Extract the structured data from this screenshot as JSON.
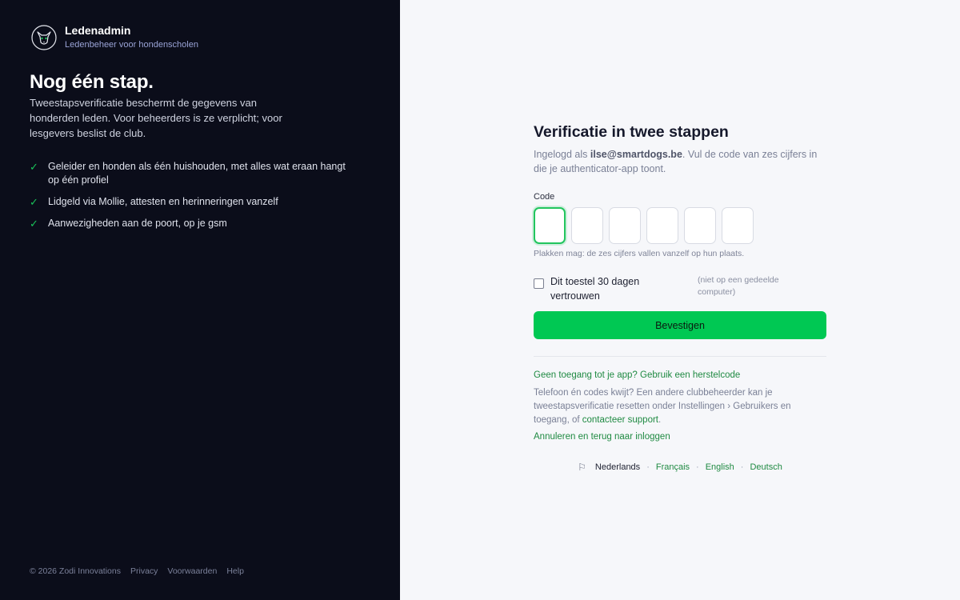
{
  "brand": {
    "name": "Ledenadmin",
    "subtitle": "Ledenbeheer voor hondenscholen"
  },
  "left": {
    "headline": "Nog één stap.",
    "intro": "Tweestapsverificatie beschermt de gegevens van honderden leden. Voor beheerders is ze verplicht; voor lesgevers beslist de club.",
    "features": [
      "Geleider en honden als één huishouden, met alles wat eraan hangt op één profiel",
      "Lidgeld via Mollie, attesten en herinneringen vanzelf",
      "Aanwezigheden aan de poort, op je gsm"
    ],
    "footer": {
      "copyright": "© 2026 Zodi Innovations",
      "privacy": "Privacy",
      "terms": "Voorwaarden",
      "help": "Help"
    }
  },
  "form": {
    "title": "Verificatie in twee stappen",
    "desc_prefix": "Ingelogd als ",
    "email": "ilse@smartdogs.be",
    "desc_suffix": ". Vul de code van zes cijfers in die je authenticator-app toont.",
    "code_label": "Code",
    "code_digits": [
      "",
      "",
      "",
      "",
      "",
      ""
    ],
    "paste_hint": "Plakken mag: de zes cijfers vallen vanzelf op hun plaats.",
    "trust_label": "Dit toestel 30 dagen vertrouwen",
    "trust_checked": false,
    "trust_note": "(niet op een gedeelde computer)",
    "confirm_button": "Bevestigen",
    "recovery_link": "Geen toegang tot je app? Gebruik een herstelcode",
    "lost_text": "Telefoon én codes kwijt? Een andere clubbeheerder kan je tweestapsverificatie resetten onder Instellingen › Gebruikers en toegang, of ",
    "support_link": "contacteer support",
    "lost_end": ".",
    "cancel_link": "Annuleren en terug naar inloggen"
  },
  "languages": {
    "current": "Nederlands",
    "others": [
      "Français",
      "English",
      "Deutsch"
    ],
    "separator": "·"
  },
  "colors": {
    "left_bg": "#0b0d1a",
    "right_bg": "#f6f7fa",
    "accent": "#00c853",
    "link": "#1f8a42"
  }
}
